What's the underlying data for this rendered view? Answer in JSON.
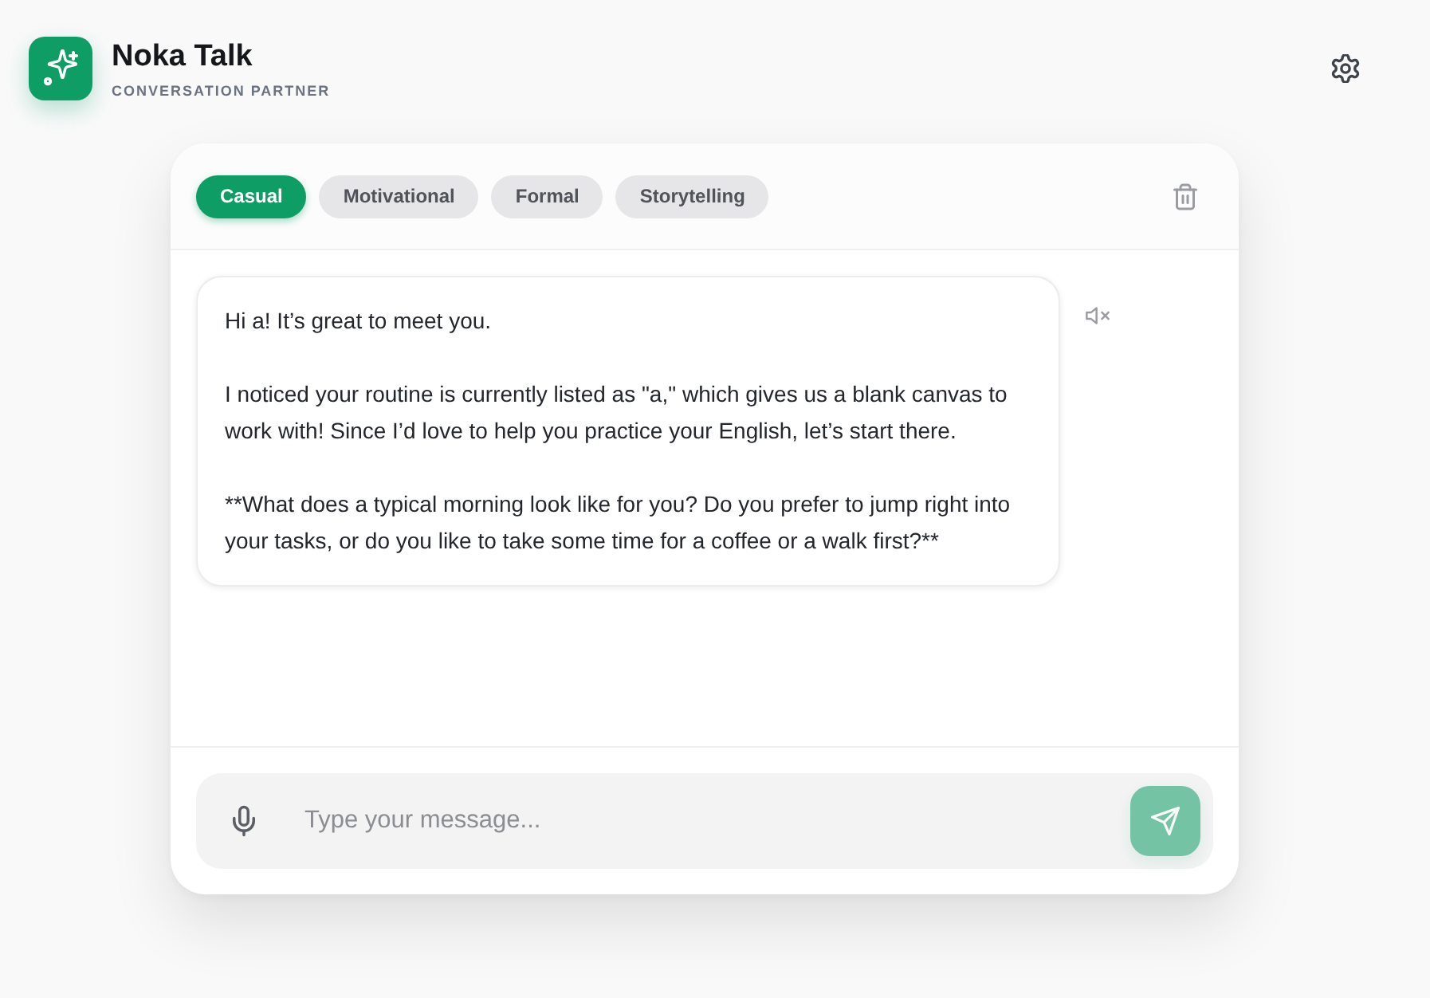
{
  "app": {
    "title": "Noka Talk",
    "subtitle": "CONVERSATION PARTNER"
  },
  "modes": [
    {
      "label": "Casual",
      "selected": true
    },
    {
      "label": "Motivational",
      "selected": false
    },
    {
      "label": "Formal",
      "selected": false
    },
    {
      "label": "Storytelling",
      "selected": false
    }
  ],
  "messages": [
    {
      "kind": "assistant",
      "text": "Hi a! It’s great to meet you.\n\nI noticed your routine is currently listed as \"a,\" which gives us a blank canvas to work with! Since I’d love to help you practice your English, let’s start there.\n\n**What does a typical morning look like for you? Do you prefer to jump right into your tasks, or do you like to take some time for a coffee or a walk first?**"
    }
  ],
  "composer": {
    "placeholder": "Type your message...",
    "send_disabled": true
  }
}
